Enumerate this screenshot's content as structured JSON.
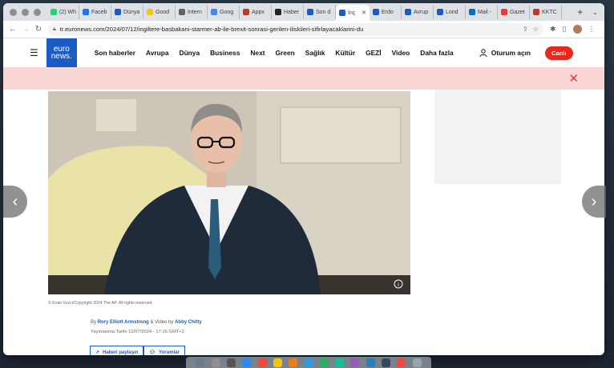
{
  "browser": {
    "tabs": [
      {
        "label": "(2) Wh",
        "color": "#25d366"
      },
      {
        "label": "Faceb",
        "color": "#1877f2"
      },
      {
        "label": "Dünya",
        "color": "#1a5cc4"
      },
      {
        "label": "Good",
        "color": "#f5c518"
      },
      {
        "label": "Intern",
        "color": "#5f6368"
      },
      {
        "label": "Goog",
        "color": "#4285f4"
      },
      {
        "label": "Appx",
        "color": "#c0392b"
      },
      {
        "label": "Haber",
        "color": "#222222"
      },
      {
        "label": "Son d",
        "color": "#1a5cc4"
      },
      {
        "label": "İnç",
        "color": "#1a5cc4",
        "active": true
      },
      {
        "label": "Erdo",
        "color": "#1a5cc4"
      },
      {
        "label": "Avrup",
        "color": "#1a5cc4"
      },
      {
        "label": "Lond",
        "color": "#1a5cc4"
      },
      {
        "label": "Mail -",
        "color": "#0072c6"
      },
      {
        "label": "Gazet",
        "color": "#e5393a"
      },
      {
        "label": "KKTC",
        "color": "#c0392b"
      }
    ],
    "url": "tr.euronews.com/2024/07/12/ingiltere-basbakani-starmer-ab-ile-brexit-sonrasi-gerilen-iliskileri-sifirlayacaklarini-du"
  },
  "site": {
    "logo_line1": "euro",
    "logo_line2": "news.",
    "nav": [
      "Son haberler",
      "Avrupa",
      "Dünya",
      "Business",
      "Next",
      "Green",
      "Sağlık",
      "Kültür",
      "GEZİ",
      "Video",
      "Daha fazla"
    ],
    "login_label": "Oturum açın",
    "live_label": "Canlı"
  },
  "article": {
    "image_caption": "© Evan Vucci/Copyright 2024 The AP. All rights reserved",
    "byline_prefix": "By",
    "author": "Rory Elliott Armstrong",
    "byline_mid": "& Video by",
    "video_author": "Abby Chitty",
    "published": "Yayınlanma Tarihi 12/07/2024 - 17:16 GMT+2",
    "share_label": "Haberi paylaşın",
    "comments_label": "Yorumlar"
  },
  "colors": {
    "brand": "#1a5cc4",
    "live": "#e8281c",
    "banner": "#f9d6d6"
  }
}
